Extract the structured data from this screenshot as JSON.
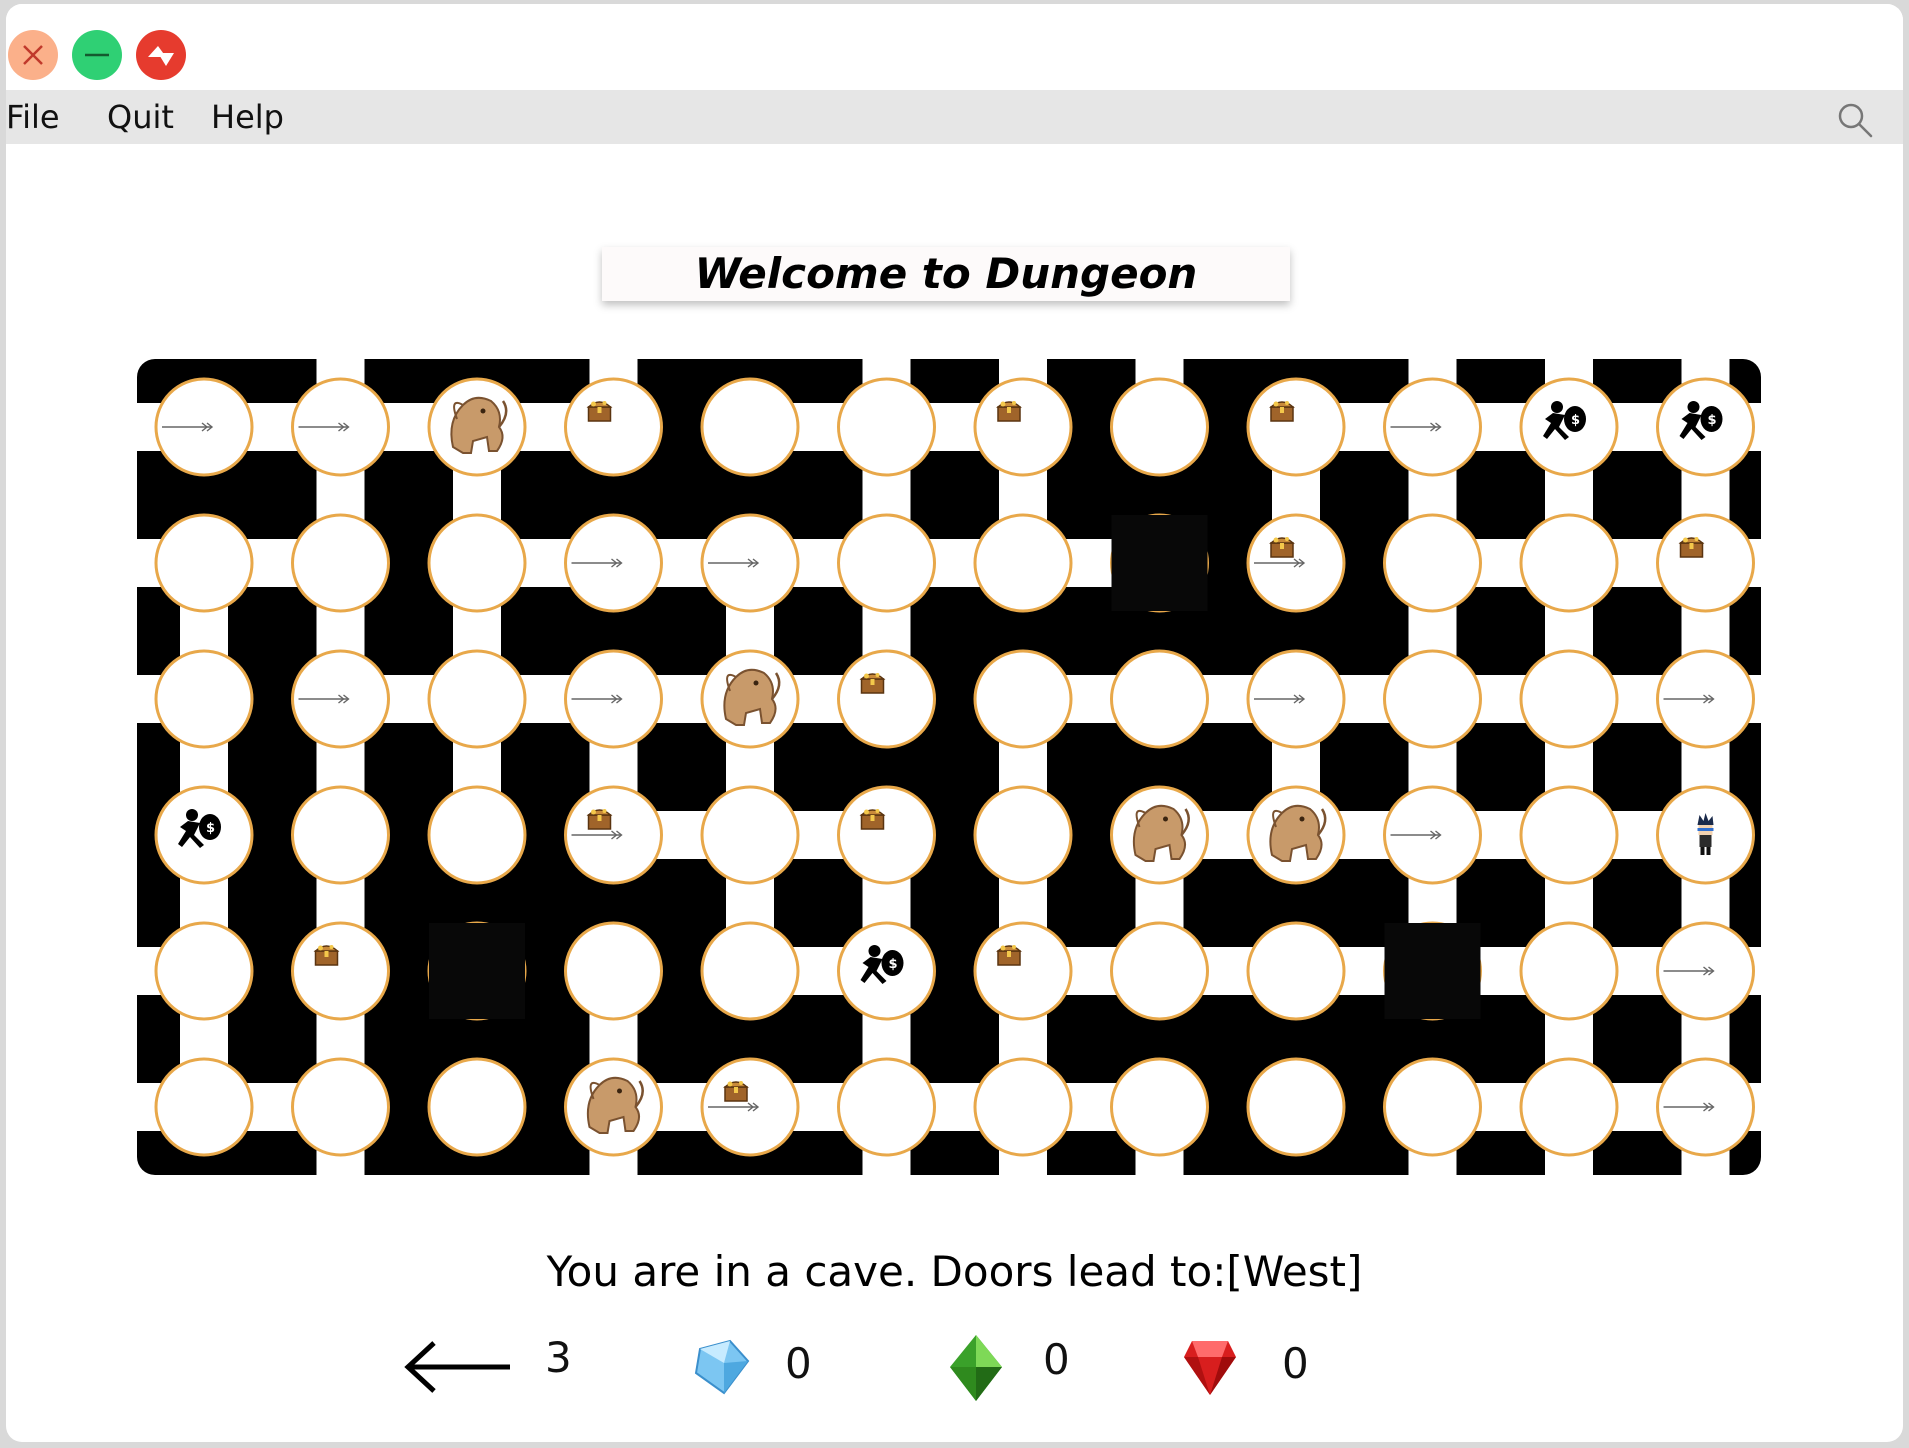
{
  "window": {
    "buttons": {
      "close": "close",
      "minimize": "minimize",
      "maximize": "maximize"
    }
  },
  "menu": {
    "items": [
      "File",
      "Quit",
      "Help"
    ]
  },
  "icons": {
    "search": "search-icon"
  },
  "title": "Welcome to Dungeon",
  "status_text": "You are in a cave. Doors lead to:[West]",
  "inventory": {
    "arrows": 3,
    "diamonds": 0,
    "emeralds": 0,
    "rubies": 0
  },
  "colors": {
    "board": "#000000",
    "cell": "#ffffff",
    "cell_rim": "#e8a84a",
    "diamond": "#7cc6f2",
    "emerald": "#2f8a1e",
    "ruby": "#d81e1e"
  },
  "dungeon": {
    "rows": 6,
    "cols": 12,
    "unexplored": [
      [
        1,
        7
      ],
      [
        4,
        2
      ],
      [
        4,
        9
      ]
    ],
    "v_edges": [
      [
        0,
        1
      ],
      [
        0,
        2
      ],
      [
        0,
        5
      ],
      [
        0,
        6
      ],
      [
        0,
        8
      ],
      [
        0,
        9
      ],
      [
        0,
        10
      ],
      [
        0,
        11
      ],
      [
        1,
        0
      ],
      [
        1,
        1
      ],
      [
        1,
        2
      ],
      [
        1,
        4
      ],
      [
        1,
        5
      ],
      [
        1,
        9
      ],
      [
        1,
        10
      ],
      [
        1,
        11
      ],
      [
        2,
        0
      ],
      [
        2,
        1
      ],
      [
        2,
        2
      ],
      [
        2,
        3
      ],
      [
        2,
        4
      ],
      [
        2,
        6
      ],
      [
        2,
        8
      ],
      [
        2,
        9
      ],
      [
        2,
        10
      ],
      [
        2,
        11
      ],
      [
        3,
        0
      ],
      [
        3,
        1
      ],
      [
        3,
        4
      ],
      [
        3,
        5
      ],
      [
        3,
        6
      ],
      [
        3,
        7
      ],
      [
        3,
        9
      ],
      [
        3,
        10
      ],
      [
        3,
        11
      ],
      [
        4,
        0
      ],
      [
        4,
        1
      ],
      [
        4,
        3
      ],
      [
        4,
        5
      ],
      [
        4,
        6
      ],
      [
        4,
        10
      ],
      [
        4,
        11
      ]
    ],
    "h_edges": [
      [
        0,
        0
      ],
      [
        0,
        1
      ],
      [
        0,
        2
      ],
      [
        0,
        4
      ],
      [
        0,
        5
      ],
      [
        0,
        8
      ],
      [
        0,
        9
      ],
      [
        0,
        10
      ],
      [
        1,
        0
      ],
      [
        1,
        2
      ],
      [
        1,
        3
      ],
      [
        1,
        4
      ],
      [
        1,
        5
      ],
      [
        1,
        6
      ],
      [
        1,
        9
      ],
      [
        1,
        10
      ],
      [
        2,
        1
      ],
      [
        2,
        2
      ],
      [
        2,
        3
      ],
      [
        2,
        4
      ],
      [
        2,
        6
      ],
      [
        2,
        7
      ],
      [
        2,
        8
      ],
      [
        2,
        9
      ],
      [
        2,
        10
      ],
      [
        3,
        3
      ],
      [
        3,
        4
      ],
      [
        3,
        7
      ],
      [
        3,
        8
      ],
      [
        3,
        9
      ],
      [
        3,
        10
      ],
      [
        4,
        4
      ],
      [
        4,
        6
      ],
      [
        4,
        7
      ],
      [
        4,
        8
      ],
      [
        4,
        9
      ],
      [
        4,
        10
      ],
      [
        5,
        0
      ],
      [
        5,
        3
      ],
      [
        5,
        4
      ],
      [
        5,
        5
      ],
      [
        5,
        6
      ],
      [
        5,
        9
      ],
      [
        5,
        10
      ]
    ],
    "wrap_left_rows": [
      0,
      1,
      2,
      4,
      5
    ],
    "wrap_right_rows": [
      0,
      1,
      2,
      4,
      5
    ],
    "wrap_top_cols": [
      1,
      3,
      5,
      6,
      7,
      9,
      10,
      11
    ],
    "wrap_bottom_cols": [
      1,
      3,
      5,
      6,
      7,
      9,
      10,
      11
    ],
    "items": [
      {
        "r": 0,
        "c": 0,
        "t": "arrow"
      },
      {
        "r": 0,
        "c": 1,
        "t": "arrow"
      },
      {
        "r": 0,
        "c": 2,
        "t": "monster"
      },
      {
        "r": 0,
        "c": 3,
        "t": "treasure"
      },
      {
        "r": 0,
        "c": 6,
        "t": "treasure"
      },
      {
        "r": 0,
        "c": 8,
        "t": "treasure"
      },
      {
        "r": 0,
        "c": 9,
        "t": "arrow"
      },
      {
        "r": 0,
        "c": 10,
        "t": "thief"
      },
      {
        "r": 0,
        "c": 11,
        "t": "thief"
      },
      {
        "r": 1,
        "c": 3,
        "t": "arrow"
      },
      {
        "r": 1,
        "c": 4,
        "t": "arrow"
      },
      {
        "r": 1,
        "c": 8,
        "t": "treasure"
      },
      {
        "r": 1,
        "c": 8,
        "t": "arrow"
      },
      {
        "r": 1,
        "c": 11,
        "t": "treasure"
      },
      {
        "r": 2,
        "c": 1,
        "t": "arrow"
      },
      {
        "r": 2,
        "c": 3,
        "t": "arrow"
      },
      {
        "r": 2,
        "c": 4,
        "t": "monster"
      },
      {
        "r": 2,
        "c": 5,
        "t": "treasure"
      },
      {
        "r": 2,
        "c": 8,
        "t": "arrow"
      },
      {
        "r": 2,
        "c": 11,
        "t": "arrow"
      },
      {
        "r": 3,
        "c": 0,
        "t": "thief"
      },
      {
        "r": 3,
        "c": 3,
        "t": "treasure"
      },
      {
        "r": 3,
        "c": 3,
        "t": "arrow"
      },
      {
        "r": 3,
        "c": 5,
        "t": "treasure"
      },
      {
        "r": 3,
        "c": 7,
        "t": "monster"
      },
      {
        "r": 3,
        "c": 8,
        "t": "monster"
      },
      {
        "r": 3,
        "c": 9,
        "t": "arrow"
      },
      {
        "r": 3,
        "c": 11,
        "t": "player"
      },
      {
        "r": 4,
        "c": 1,
        "t": "treasure"
      },
      {
        "r": 4,
        "c": 5,
        "t": "thief"
      },
      {
        "r": 4,
        "c": 6,
        "t": "treasure"
      },
      {
        "r": 4,
        "c": 11,
        "t": "arrow"
      },
      {
        "r": 5,
        "c": 3,
        "t": "monster"
      },
      {
        "r": 5,
        "c": 4,
        "t": "treasure"
      },
      {
        "r": 5,
        "c": 4,
        "t": "arrow"
      },
      {
        "r": 5,
        "c": 11,
        "t": "arrow"
      }
    ]
  }
}
